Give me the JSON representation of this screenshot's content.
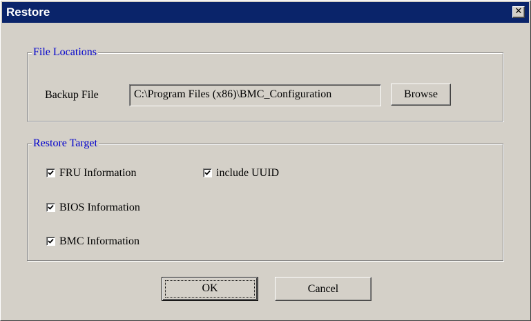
{
  "window": {
    "title": "Restore",
    "close_glyph": "✕"
  },
  "file_locations": {
    "group_label": "File Locations",
    "backup_file_label": "Backup File",
    "backup_file_value": "C:\\Program Files (x86)\\BMC_Configuration",
    "browse_label": "Browse"
  },
  "restore_target": {
    "group_label": "Restore Target",
    "options": [
      {
        "label": "FRU Information",
        "checked": true
      },
      {
        "label": "include UUID",
        "checked": true
      },
      {
        "label": "BIOS Information",
        "checked": true
      },
      {
        "label": "BMC Information",
        "checked": true
      }
    ]
  },
  "buttons": {
    "ok_label": "OK",
    "cancel_label": "Cancel"
  },
  "colors": {
    "titlebar": "#0a246a",
    "dialog_face": "#d4d0c8",
    "group_label_text": "#0000cc"
  }
}
